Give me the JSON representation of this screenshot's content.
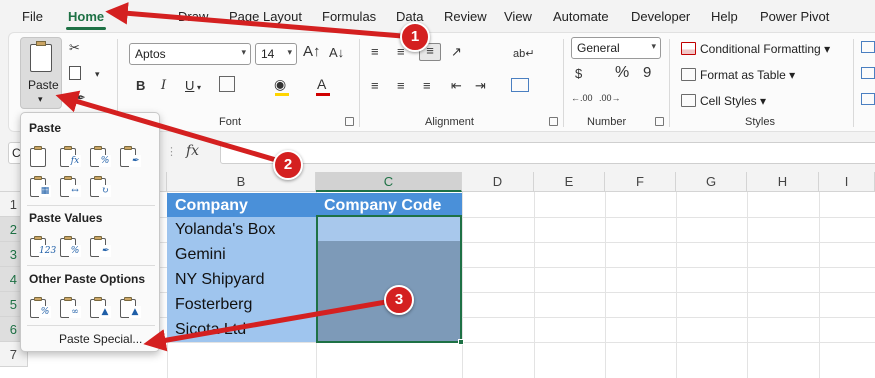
{
  "menu": {
    "items": [
      "File",
      "Home",
      "Draw",
      "Page Layout",
      "Formulas",
      "Data",
      "Review",
      "View",
      "Automate",
      "Developer",
      "Help",
      "Power Pivot"
    ],
    "active": "Home"
  },
  "ribbon": {
    "paste_label": "Paste",
    "font_name": "Aptos",
    "font_size": "14",
    "number_format": "General",
    "conditional_formatting": "Conditional Formatting",
    "format_as_table": "Format as Table",
    "cell_styles": "Cell Styles",
    "groups": {
      "font": "Font",
      "alignment": "Alignment",
      "number": "Number",
      "styles": "Styles"
    }
  },
  "formula_bar": {
    "name_box": "C",
    "fx": "fx",
    "value": ""
  },
  "sheet": {
    "columns": [
      "B",
      "C",
      "D",
      "E",
      "F",
      "G",
      "H",
      "I"
    ],
    "rows": [
      "1",
      "2",
      "3",
      "4",
      "5",
      "6",
      "7"
    ],
    "header": [
      "Company",
      "Company Code"
    ],
    "companies": [
      "Yolanda's Box",
      "Gemini",
      "NY Shipyard",
      "Fosterberg",
      "Sicota Ltd"
    ]
  },
  "paste_menu": {
    "paste_heading": "Paste",
    "paste_values_heading": "Paste Values",
    "other_options_heading": "Other Paste Options",
    "paste_special": "Paste Special..."
  },
  "callouts": [
    "1",
    "2",
    "3"
  ],
  "colors": {
    "accent": "#1e7145",
    "annotation": "#d42020",
    "header_fill": "#4a90d9",
    "body_fill": "#9fc5ee"
  }
}
